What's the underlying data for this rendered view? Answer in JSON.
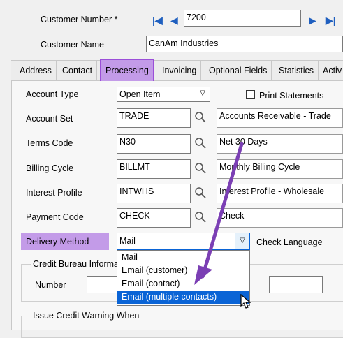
{
  "header": {
    "customer_number_label": "Customer Number *",
    "customer_number_value": "7200",
    "customer_name_label": "Customer Name",
    "customer_name_value": "CanAm Industries"
  },
  "tabs": [
    {
      "label": "Address"
    },
    {
      "label": "Contact"
    },
    {
      "label": "Processing"
    },
    {
      "label": "Invoicing"
    },
    {
      "label": "Optional Fields"
    },
    {
      "label": "Statistics"
    },
    {
      "label": "Activ"
    }
  ],
  "form": {
    "account_type_label": "Account Type",
    "account_type_value": "Open Item",
    "print_statements_label": "Print Statements",
    "account_set_label": "Account Set",
    "account_set_value": "TRADE",
    "account_set_desc": "Accounts Receivable - Trade",
    "terms_code_label": "Terms Code",
    "terms_code_value": "N30",
    "terms_code_desc": "Net 30 Days",
    "billing_cycle_label": "Billing Cycle",
    "billing_cycle_value": "BILLMT",
    "billing_cycle_desc": "Monthly Billing Cycle",
    "interest_profile_label": "Interest Profile",
    "interest_profile_value": "INTWHS",
    "interest_profile_desc": "Interest Profile - Wholesale",
    "payment_code_label": "Payment Code",
    "payment_code_value": "CHECK",
    "payment_code_desc": "Check",
    "delivery_method_label": "Delivery Method",
    "delivery_method_value": "Mail",
    "check_language_label": "Check Language",
    "credit_bureau_label": "Credit Bureau Informa",
    "number_label": "Number",
    "issue_credit_label": "Issue Credit Warning When"
  },
  "dropdown": {
    "options": [
      "Mail",
      "Email (customer)",
      "Email (contact)",
      "Email (multiple contacts)"
    ],
    "highlighted_index": 3
  },
  "colors": {
    "highlight_purple": "#9b4fd8",
    "highlight_fill": "#c39be8",
    "selection_blue": "#0a64d6",
    "arrow_purple": "#7b3fb4"
  }
}
